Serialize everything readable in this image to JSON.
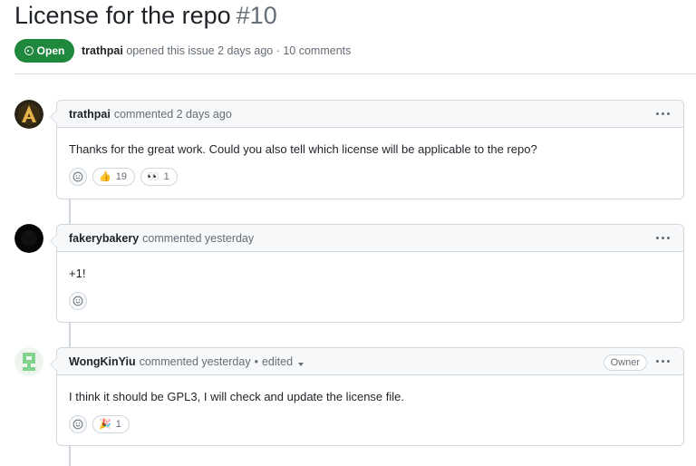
{
  "issue": {
    "title": "License for the repo",
    "number": "#10",
    "state": "Open",
    "author": "trathpai",
    "meta_rest": "opened this issue 2 days ago · 10 comments"
  },
  "comments": [
    {
      "author": "trathpai",
      "action": "commented 2 days ago",
      "body": "Thanks for the great work. Could you also tell which license will be applicable to the repo?",
      "reactions": [
        {
          "emoji": "👍",
          "count": "19"
        },
        {
          "emoji": "👀",
          "count": "1"
        }
      ]
    },
    {
      "author": "fakerybakery",
      "action": "commented yesterday",
      "body": "+1!",
      "reactions": []
    },
    {
      "author": "WongKinYiu",
      "action": "commented yesterday",
      "edited": "edited",
      "badge": "Owner",
      "body": "I think it should be GPL3, I will check and update the license file.",
      "reactions": [
        {
          "emoji": "🎉",
          "count": "1"
        }
      ]
    }
  ],
  "colors": {
    "open_green": "#1f883d",
    "border": "#d0d7de",
    "header_bg": "#f6f8fa",
    "muted": "#656d76"
  },
  "icons": {
    "state": "issue-opened-icon",
    "more": "kebab-horizontal-icon",
    "add_reaction": "smiley-icon"
  }
}
